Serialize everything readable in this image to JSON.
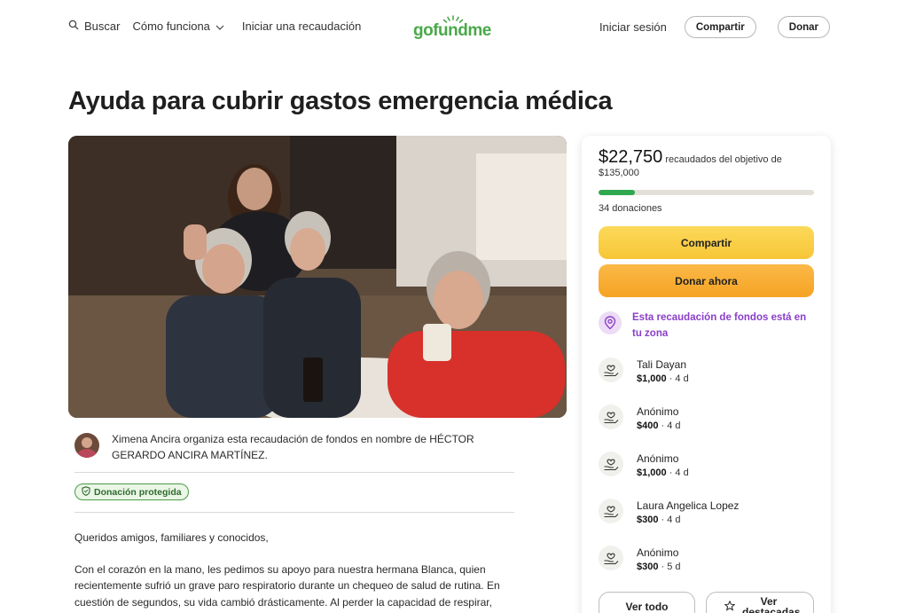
{
  "header": {
    "search_label": "Buscar",
    "how_label": "Cómo funciona",
    "start_label": "Iniciar una recaudación",
    "logo_text": "gofundme",
    "signin_label": "Iniciar sesión",
    "share_label": "Compartir",
    "donate_label": "Donar"
  },
  "campaign": {
    "title": "Ayuda para cubrir gastos emergencia médica",
    "organizer_text": "Ximena Ancira organiza esta recaudación de fondos en nombre de HÉCTOR GERARDO ANCIRA MARTÍNEZ.",
    "badge_label": "Donación protegida",
    "story": [
      "Queridos amigos, familiares y conocidos,",
      "Con el corazón en la mano, les pedimos su apoyo para nuestra hermana Blanca, quien recientemente sufrió un grave paro respiratorio durante un chequeo de salud de rutina. En cuestión de segundos, su vida cambió drásticamente. Al perder la capacidad de respirar,"
    ]
  },
  "sidebar": {
    "raised_amount": "$22,750",
    "raised_suffix": "recaudados del objetivo de",
    "goal_amount": "$135,000",
    "progress_fraction": 0.168,
    "donations_count": "34 donaciones",
    "share_button": "Compartir",
    "donate_button": "Donar ahora",
    "zone_text": "Esta recaudación de fondos está en tu zona",
    "donors": [
      {
        "name": "Tali Dayan",
        "amount": "$1,000",
        "time": " · 4 d"
      },
      {
        "name": "Anónimo",
        "amount": "$400",
        "time": " · 4 d"
      },
      {
        "name": "Anónimo",
        "amount": "$1,000",
        "time": " · 4 d"
      },
      {
        "name": "Laura Angelica Lopez",
        "amount": "$300",
        "time": " · 4 d"
      },
      {
        "name": "Anónimo",
        "amount": "$300",
        "time": " · 5 d"
      }
    ],
    "see_all_button": "Ver todo",
    "see_top_button": "Ver destacadas"
  },
  "colors": {
    "brand_green": "#4aa84a",
    "progress_green": "#2fa84f",
    "zone_purple": "#8a3ec9",
    "share_yellow": "#fbd44e",
    "donate_orange": "#f7ac2e"
  },
  "icons": [
    "search-icon",
    "chevron-down-icon",
    "shield-icon",
    "location-pin-icon",
    "donation-hand-icon",
    "star-icon"
  ]
}
